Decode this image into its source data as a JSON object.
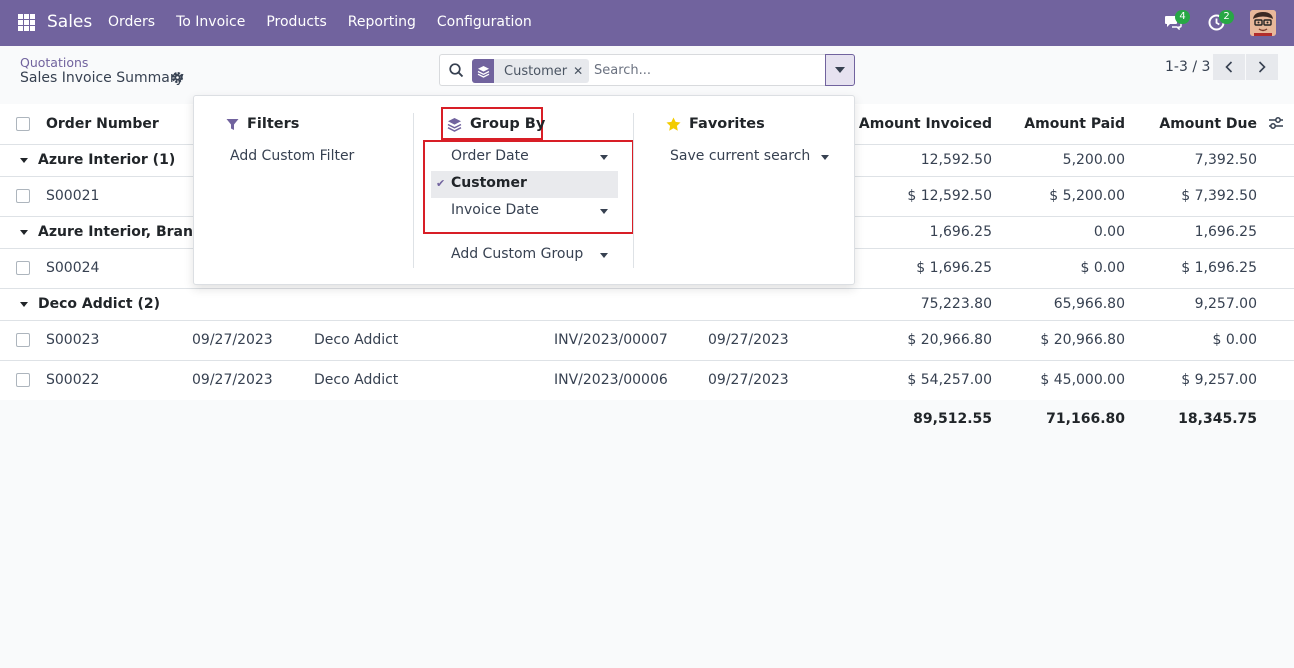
{
  "navbar": {
    "brand": "Sales",
    "menu": [
      "Orders",
      "To Invoice",
      "Products",
      "Reporting",
      "Configuration"
    ],
    "chat_badge": "4",
    "activity_badge": "2"
  },
  "control_panel": {
    "breadcrumb_parent": "Quotations",
    "breadcrumb_current": "Sales Invoice Summary",
    "search_facet": "Customer",
    "search_placeholder": "Search...",
    "pager": "1-3 / 3"
  },
  "table": {
    "headers": {
      "order_number": "Order Number",
      "amount_invoiced": "Amount Invoiced",
      "amount_paid": "Amount Paid",
      "amount_due": "Amount Due"
    },
    "groups": [
      {
        "label": "Azure Interior (1)",
        "amount_invoiced": "12,592.50",
        "amount_paid": "5,200.00",
        "amount_due": "7,392.50",
        "rows": [
          {
            "order": "S00021",
            "date": "",
            "customer": "",
            "invoice": "",
            "invoice_date": "",
            "amount_invoiced": "$ 12,592.50",
            "amount_paid": "$ 5,200.00",
            "amount_due": "$ 7,392.50"
          }
        ]
      },
      {
        "label": "Azure Interior, Brandon",
        "amount_invoiced": "1,696.25",
        "amount_paid": "0.00",
        "amount_due": "1,696.25",
        "rows": [
          {
            "order": "S00024",
            "date": "",
            "customer": "",
            "invoice": "",
            "invoice_date": "",
            "amount_invoiced": "$ 1,696.25",
            "amount_paid": "$ 0.00",
            "amount_due": "$ 1,696.25"
          }
        ]
      },
      {
        "label": "Deco Addict (2)",
        "amount_invoiced": "75,223.80",
        "amount_paid": "65,966.80",
        "amount_due": "9,257.00",
        "rows": [
          {
            "order": "S00023",
            "date": "09/27/2023",
            "customer": "Deco Addict",
            "invoice": "INV/2023/00007",
            "invoice_date": "09/27/2023",
            "amount_invoiced": "$ 20,966.80",
            "amount_paid": "$ 20,966.80",
            "amount_due": "$ 0.00"
          },
          {
            "order": "S00022",
            "date": "09/27/2023",
            "customer": "Deco Addict",
            "invoice": "INV/2023/00006",
            "invoice_date": "09/27/2023",
            "amount_invoiced": "$ 54,257.00",
            "amount_paid": "$ 45,000.00",
            "amount_due": "$ 9,257.00"
          }
        ]
      }
    ],
    "totals": {
      "amount_invoiced": "89,512.55",
      "amount_paid": "71,166.80",
      "amount_due": "18,345.75"
    }
  },
  "dropdown": {
    "filters": {
      "title": "Filters",
      "add_custom": "Add Custom Filter"
    },
    "group_by": {
      "title": "Group By",
      "options": [
        {
          "label": "Order Date",
          "selected": false
        },
        {
          "label": "Customer",
          "selected": true
        },
        {
          "label": "Invoice Date",
          "selected": false
        }
      ],
      "add_custom": "Add Custom Group"
    },
    "favorites": {
      "title": "Favorites",
      "save_current": "Save current search"
    }
  },
  "colors": {
    "brand": "#71639e",
    "highlight": "#d81e26",
    "badge": "#28a745"
  }
}
